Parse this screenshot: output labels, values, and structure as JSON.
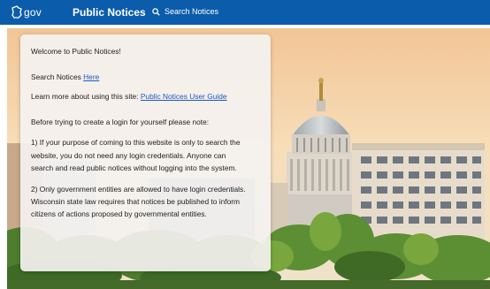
{
  "header": {
    "logo_text": "gov",
    "brand": "Public Notices",
    "search_label": "Search Notices"
  },
  "panel": {
    "welcome": "Welcome to Public Notices!",
    "search_prefix": "Search Notices",
    "search_link": "Here",
    "learn_prefix": "Learn more about using this site:",
    "guide_link": "Public Notices User Guide",
    "note_intro": "Before trying to create a login for yourself please note:",
    "point1_line1": "1) If your purpose of coming to this website is only to search the",
    "point1_line2": "website, you do not need any login credentials. Anyone can",
    "point1_line3": "search and read public notices without logging into the system.",
    "point2_line1": "2) Only government entities are allowed to have login credentials.",
    "point2_line2": "Wisconsin state law requires that notices be published to inform",
    "point2_line3": "citizens of actions proposed by governmental entities."
  },
  "colors": {
    "nav": "#0b5cab",
    "link": "#1a59c9"
  }
}
